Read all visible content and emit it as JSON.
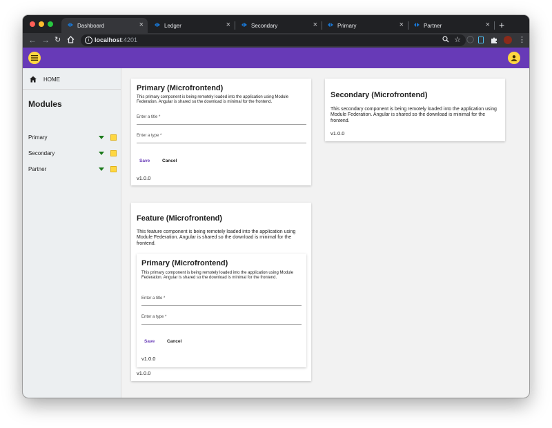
{
  "browser": {
    "tabs": [
      {
        "label": "Dashboard",
        "active": true
      },
      {
        "label": "Ledger",
        "active": false
      },
      {
        "label": "Secondary",
        "active": false
      },
      {
        "label": "Primary",
        "active": false
      },
      {
        "label": "Partner",
        "active": false
      }
    ],
    "new_tab": "+",
    "url_host": "localhost",
    "url_port": ":4201"
  },
  "sidebar": {
    "home_label": "HOME",
    "modules_title": "Modules",
    "items": [
      {
        "label": "Primary"
      },
      {
        "label": "Secondary"
      },
      {
        "label": "Partner"
      }
    ]
  },
  "cards": {
    "primary": {
      "title": "Primary (Microfrontend)",
      "description": "This primary component is being remotely loaded into the application using Module Federation. Angular is shared so the download is minimal for the frontend.",
      "title_placeholder": "Enter a title *",
      "type_placeholder": "Enter a type *",
      "save_label": "Save",
      "cancel_label": "Cancel",
      "version": "v1.0.0"
    },
    "secondary": {
      "title": "Secondary (Microfrontend)",
      "description": "This secondary component is being remotely loaded into the application using Module Federation. Angular is shared so the download is minimal for the frontend.",
      "version": "v1.0.0"
    },
    "feature": {
      "title": "Feature (Microfrontend)",
      "description": "This feature component is being remotely loaded into the application using Module Federation. Angular is shared so the download is minimal for the frontend.",
      "version": "v1.0.0",
      "nested_primary": {
        "title": "Primary (Microfrontend)",
        "description": "This primary component is being remotely loaded into the application using Module Federation. Angular is shared so the download is minimal for the frontend.",
        "title_placeholder": "Enter a title *",
        "type_placeholder": "Enter a type *",
        "save_label": "Save",
        "cancel_label": "Cancel",
        "version": "v1.0.0"
      }
    }
  },
  "colors": {
    "appbar": "#673ab7",
    "accent": "#ffd740",
    "sidebar_bg": "#eceff1",
    "content_bg": "#f2f2f2",
    "status_indicator": "#1b7a1b"
  }
}
